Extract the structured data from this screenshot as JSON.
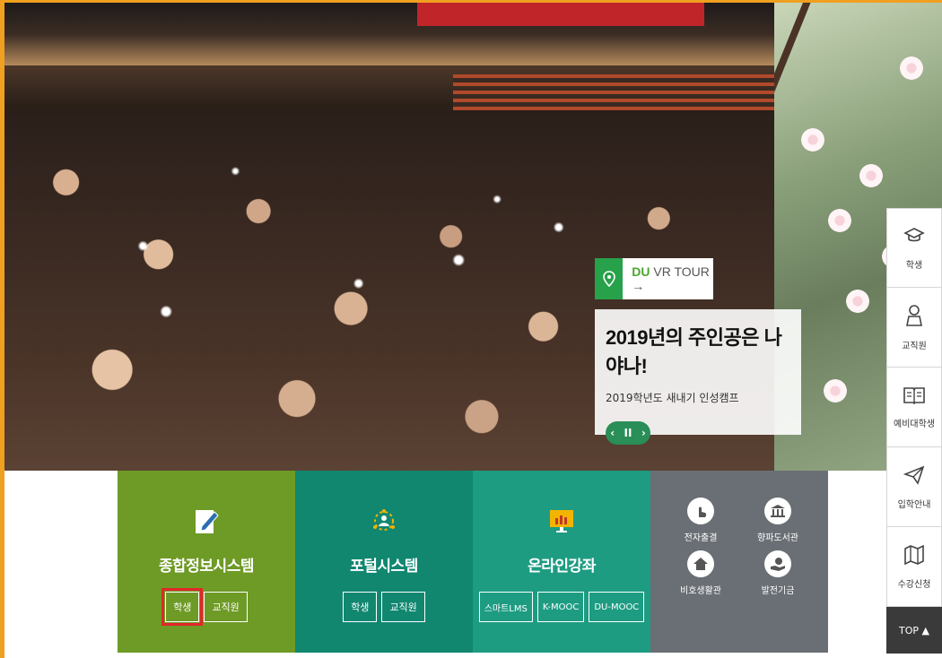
{
  "hero": {
    "vr_tour": {
      "brand": "DU",
      "label": "VR TOUR →"
    },
    "caption": {
      "title": "2019년의 주인공은 나야나!",
      "subtitle": "2019학년도 새내기 인성캠프",
      "prev": "‹",
      "pause": "II",
      "next": "›"
    }
  },
  "tiles": [
    {
      "name": "종합정보시스템",
      "icon": "pencil-doc-icon",
      "buttons": [
        "학생",
        "교직원"
      ],
      "selected": "학생"
    },
    {
      "name": "포털시스템",
      "icon": "network-icon",
      "buttons": [
        "학생",
        "교직원"
      ]
    },
    {
      "name": "온라인강좌",
      "icon": "monitor-chart-icon",
      "buttons": [
        "스마트LMS",
        "K-MOOC",
        "DU-MOOC"
      ]
    },
    {
      "name": "",
      "items": [
        {
          "label": "전자출결",
          "icon": "touch-icon"
        },
        {
          "label": "향파도서관",
          "icon": "library-icon"
        },
        {
          "label": "비호생활관",
          "icon": "house-icon"
        },
        {
          "label": "발전기금",
          "icon": "donation-icon"
        }
      ]
    }
  ],
  "quick_menu": [
    {
      "label": "학생",
      "icon": "graduation-cap-icon"
    },
    {
      "label": "교직원",
      "icon": "person-icon"
    },
    {
      "label": "예비대학생",
      "icon": "book-icon"
    },
    {
      "label": "입학안내",
      "icon": "paper-plane-icon"
    },
    {
      "label": "수강신청",
      "icon": "map-icon"
    }
  ],
  "top_button": "TOP ▲",
  "colors": {
    "green": "#6e9a26",
    "teal": "#118770",
    "teal2": "#1d9c82",
    "gray": "#6a6f75",
    "frame": "#f0a020"
  }
}
